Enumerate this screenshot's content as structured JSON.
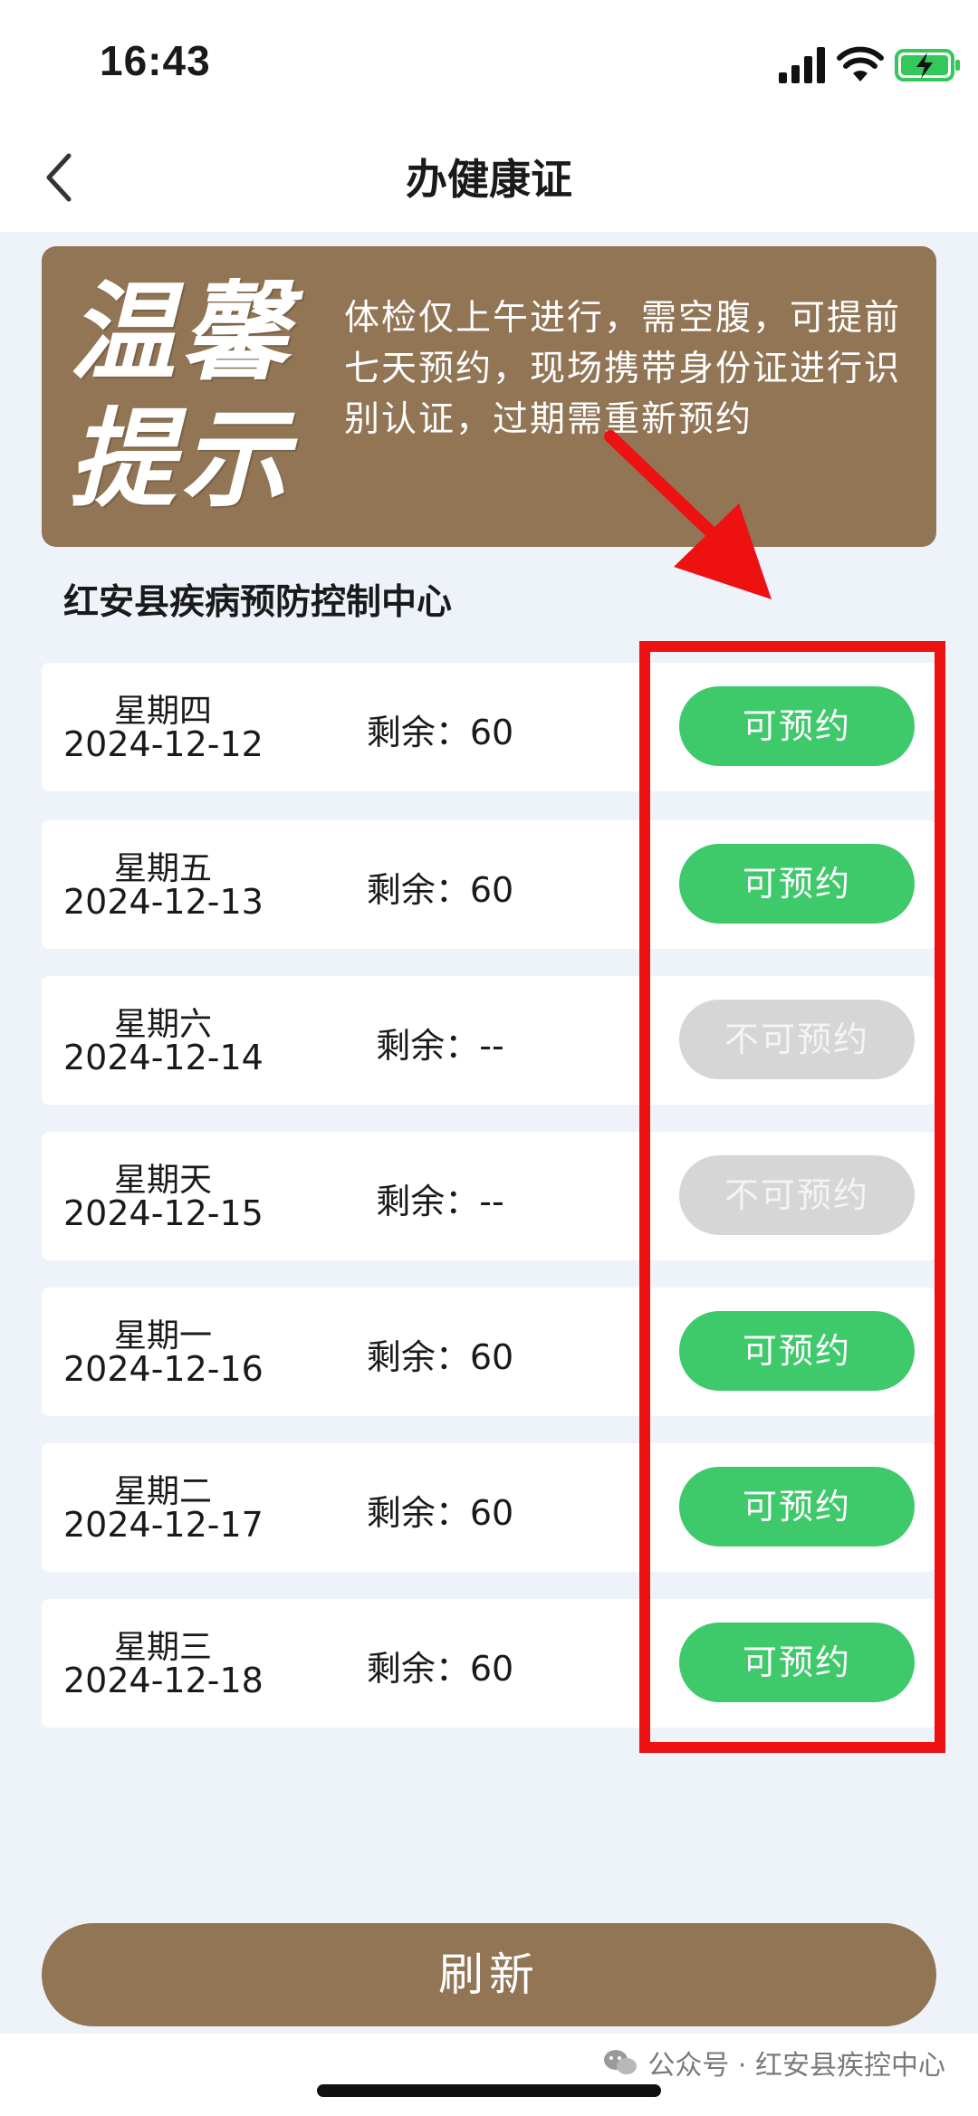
{
  "status_bar": {
    "time": "16:43"
  },
  "header": {
    "title": "办健康证"
  },
  "notice": {
    "title_line1": "温馨",
    "title_line2": "提示",
    "body": "体检仅上午进行，需空腹，可提前七天预约，现场携带身份证进行识别认证，过期需重新预约"
  },
  "center_name": "红安县疾病预防控制中心",
  "slots": [
    {
      "weekday": "星期四",
      "date": "2024-12-12",
      "remaining": "剩余：60",
      "button": "可预约",
      "available": true
    },
    {
      "weekday": "星期五",
      "date": "2024-12-13",
      "remaining": "剩余：60",
      "button": "可预约",
      "available": true
    },
    {
      "weekday": "星期六",
      "date": "2024-12-14",
      "remaining": "剩余：--",
      "button": "不可预约",
      "available": false
    },
    {
      "weekday": "星期天",
      "date": "2024-12-15",
      "remaining": "剩余：--",
      "button": "不可预约",
      "available": false
    },
    {
      "weekday": "星期一",
      "date": "2024-12-16",
      "remaining": "剩余：60",
      "button": "可预约",
      "available": true
    },
    {
      "weekday": "星期二",
      "date": "2024-12-17",
      "remaining": "剩余：60",
      "button": "可预约",
      "available": true
    },
    {
      "weekday": "星期三",
      "date": "2024-12-18",
      "remaining": "剩余：60",
      "button": "可预约",
      "available": true
    }
  ],
  "refresh_label": "刷新",
  "watermark": "公众号 · 红安县疾控中心",
  "colors": {
    "brand_brown": "#917555",
    "available_green": "#3ec96a",
    "unavailable_gray": "#d6d6d6",
    "annotation_red": "#ee1111",
    "page_bg": "#eef3fa"
  },
  "icons": [
    "back-chevron-icon",
    "signal-icon",
    "wifi-icon",
    "battery-charging-icon",
    "wechat-icon"
  ]
}
